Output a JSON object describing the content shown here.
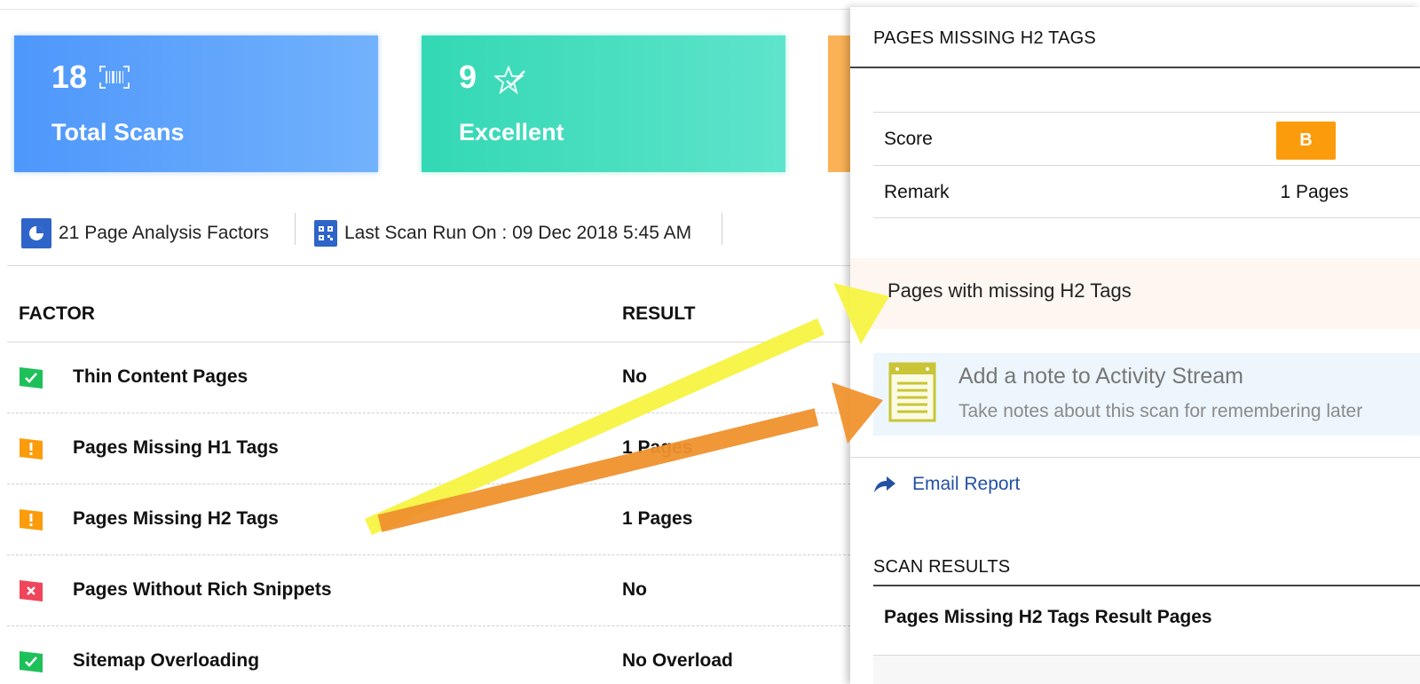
{
  "stats": [
    {
      "value": "18",
      "label": "Total Scans",
      "icon": "barcode-icon",
      "color": "#4e97fb"
    },
    {
      "value": "9",
      "label": "Excellent",
      "icon": "star-check-icon",
      "color": "#33d8b4"
    },
    {
      "value": "",
      "label": "",
      "icon": "",
      "color": "#fbb155"
    }
  ],
  "info": {
    "factors": "21 Page Analysis Factors",
    "last_scan": "Last Scan Run On : 09 Dec 2018 5:45 AM"
  },
  "table": {
    "headers": {
      "factor": "FACTOR",
      "result": "RESULT"
    },
    "rows": [
      {
        "status": "pass",
        "factor": "Thin Content Pages",
        "result": "No"
      },
      {
        "status": "warning",
        "factor": "Pages Missing H1 Tags",
        "result": "1 Pages"
      },
      {
        "status": "warning",
        "factor": "Pages Missing H2 Tags",
        "result": "1 Pages"
      },
      {
        "status": "fail",
        "factor": "Pages Without Rich Snippets",
        "result": "No"
      },
      {
        "status": "pass",
        "factor": "Sitemap Overloading",
        "result": "No Overload"
      }
    ]
  },
  "colors": {
    "pass": "#1ec05a",
    "warning": "#fb9c0c",
    "fail": "#f0455a",
    "arrow_yellow": "#f7f442",
    "arrow_orange": "#f0922e"
  },
  "panel": {
    "title": "PAGES MISSING H2 TAGS",
    "score_label": "Score",
    "score_value": "B",
    "remark_label": "Remark",
    "remark_value": "1 Pages",
    "missing_text": "Pages with missing H2 Tags",
    "note_title": "Add a note to Activity Stream",
    "note_sub": "Take notes about this scan for remembering later",
    "email_label": "Email Report",
    "scan_results_title": "SCAN RESULTS",
    "result_pages_label": "Pages Missing H2 Tags Result Pages"
  }
}
